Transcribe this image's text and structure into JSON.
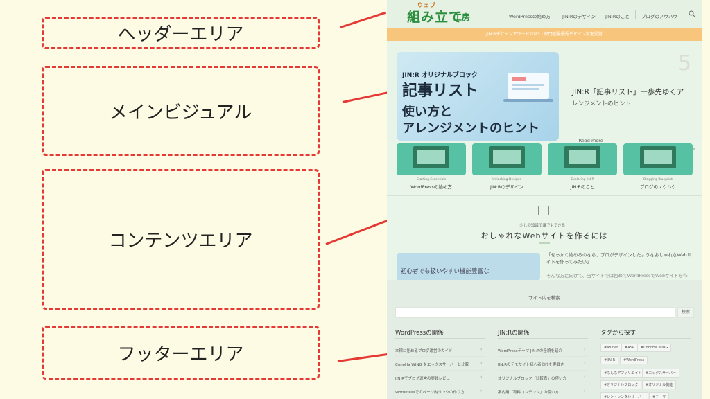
{
  "annotations": {
    "header": "ヘッダーエリア",
    "main_visual": "メインビジュアル",
    "content": "コンテンツエリア",
    "footer": "フッターエリア"
  },
  "site": {
    "logo_small": "ウェブ",
    "logo_main": "組み立て",
    "logo_sub": "工房",
    "nav": [
      "WordPressの始め方",
      "JIN:Rのデザイン",
      "JIN:Rのこと",
      "ブログのノウハウ"
    ],
    "banner": "JIN:Rデザインアワード2023・部門別最優秀デザイン賞を受賞",
    "main_visual": {
      "tag": "JIN:R オリジナルブロック",
      "title": "記事リスト",
      "line2": "使い方と",
      "line3": "アレンジメントのヒント",
      "right_title": "JIN:R「記事リスト」一歩先ゆくア",
      "right_sub": "レンジメントのヒント",
      "slide_number": "5",
      "read_more": "— Read more"
    },
    "categories": [
      {
        "en": "Starting Essentials",
        "jp": "WordPressの始め方"
      },
      {
        "en": "Unlocking Designs",
        "jp": "JIN:Rのデザイン"
      },
      {
        "en": "Exploring JIN:R",
        "jp": "JIN:Rのこと"
      },
      {
        "en": "Blogging Blueprint",
        "jp": "ブログのノウハウ"
      }
    ],
    "section": {
      "subtitle": "少しの知識で誰でもできる！",
      "title": "おしゃれなWebサイトを作るには",
      "card_text": "初心者でも扱いやすい機能豊富な",
      "intro1": "「せっかく始めるのなら、プロがデザインしたようなおしゃれなWebサイトを作ってみたい」",
      "intro2": "そんな方に向けて、当サイトでは初めてWordPressでWebサイトを作"
    },
    "footer": {
      "search_label": "サイト内を検索",
      "search_button": "検索",
      "col1_title": "WordPressの関係",
      "col1_links": [
        "本稼に始めるブログ運営のガイド",
        "ConoHa WING をエックスサーバーと比較",
        "JIN:Rでブログ運営の実践レビュー",
        "WordPressでのページ内リンクの作り方"
      ],
      "col2_title": "JIN:Rの関係",
      "col2_links": [
        "WordPressテーマ JIN:Rの全貌を紹介",
        "JIN:Rのデモサイト初心者向けを実戦さ",
        "オリジナルブロック「比較表」の使い方",
        "案内用「有料コンテンツ」の使い方"
      ],
      "col3_title": "タグから探す",
      "tags": [
        "#a8.net",
        "#ASP",
        "#ConoHa WING",
        "#JIN:R",
        "#WordPress",
        "#もしもアフィリエイト",
        "#エックスサーバー",
        "#オリジナルブロック",
        "#オリジナル機能",
        "#レン・レンタルサーバー",
        "#テーマ"
      ]
    }
  }
}
